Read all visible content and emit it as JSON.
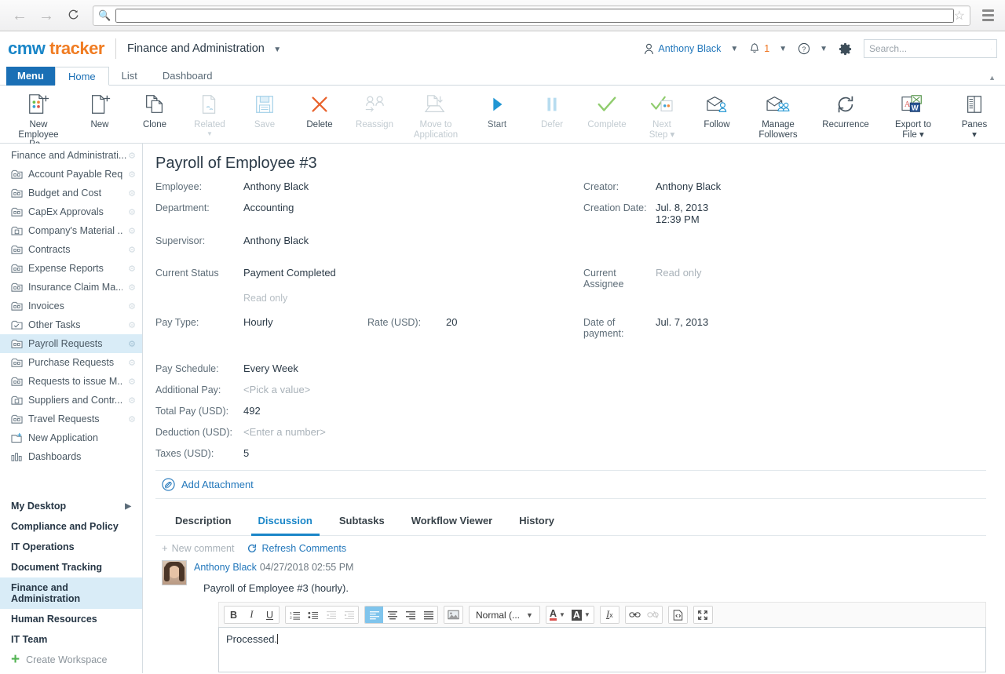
{
  "browser": {
    "back_icon": "back-arrow-icon",
    "forward_icon": "forward-arrow-icon",
    "reload_icon": "reload-icon",
    "url_value": "",
    "url_placeholder": "",
    "star_icon": "bookmark-star-icon",
    "menu_icon": "browser-menu-icon"
  },
  "header": {
    "logo_cmw": "cmw",
    "logo_tracker": "tracker",
    "workspace": "Finance and Administration",
    "user_name": "Anthony Black",
    "notifications_count": "1",
    "help_icon": "help-question-icon",
    "settings_icon": "gear-icon",
    "search_placeholder": "Search...",
    "search_value": ""
  },
  "ribbon_tabs": [
    {
      "label": "Menu",
      "state": "menu"
    },
    {
      "label": "Home",
      "state": "active"
    },
    {
      "label": "List",
      "state": "normal"
    },
    {
      "label": "Dashboard",
      "state": "normal"
    }
  ],
  "toolbar": {
    "items": [
      {
        "label": "New\nEmployee Pa...",
        "line1": "New",
        "line2": "Employee Pa...",
        "icon": "new-employee-payroll-icon",
        "disabled": false
      },
      {
        "label": "New",
        "line1": "New",
        "line2": "",
        "icon": "new-document-icon",
        "disabled": false
      },
      {
        "label": "Clone",
        "line1": "Clone",
        "line2": "",
        "icon": "clone-icon",
        "disabled": false
      },
      {
        "label": "Related",
        "line1": "Related",
        "line2": "",
        "icon": "related-icon",
        "disabled": true
      },
      {
        "label": "Save",
        "line1": "Save",
        "line2": "",
        "icon": "save-disk-icon",
        "disabled": true
      },
      {
        "label": "Delete",
        "line1": "Delete",
        "line2": "",
        "icon": "delete-x-icon",
        "disabled": false
      },
      {
        "label": "Reassign",
        "line1": "Reassign",
        "line2": "",
        "icon": "reassign-users-icon",
        "disabled": true
      },
      {
        "label": "Move to Application",
        "line1": "Move to",
        "line2": "Application",
        "icon": "move-to-application-icon",
        "disabled": true
      },
      {
        "label": "Start",
        "line1": "Start",
        "line2": "",
        "icon": "start-play-icon",
        "disabled": false
      },
      {
        "label": "Defer",
        "line1": "Defer",
        "line2": "",
        "icon": "defer-pause-icon",
        "disabled": true
      },
      {
        "label": "Complete",
        "line1": "Complete",
        "line2": "",
        "icon": "complete-check-icon",
        "disabled": true
      },
      {
        "label": "Next Step",
        "line1": "Next",
        "line2": "Step ▾",
        "icon": "next-step-icon",
        "disabled": true
      },
      {
        "label": "Follow",
        "line1": "Follow",
        "line2": "",
        "icon": "follow-envelope-icon",
        "disabled": false
      },
      {
        "label": "Manage Followers",
        "line1": "Manage",
        "line2": "Followers",
        "icon": "manage-followers-icon",
        "disabled": false
      },
      {
        "label": "Recurrence",
        "line1": "Recurrence",
        "line2": "",
        "icon": "recurrence-refresh-icon",
        "disabled": false
      },
      {
        "label": "Export to File",
        "line1": "Export to",
        "line2": "File ▾",
        "icon": "export-to-file-icon",
        "disabled": false
      },
      {
        "label": "Panes",
        "line1": "Panes",
        "line2": "▾",
        "icon": "panes-icon",
        "disabled": false
      }
    ]
  },
  "sidebar": {
    "root_label": "Finance and Administrati...",
    "apps": [
      {
        "label": "Account Payable Req...",
        "icon": "application-icon"
      },
      {
        "label": "Budget and Cost",
        "icon": "application-icon"
      },
      {
        "label": "CapEx Approvals",
        "icon": "application-icon"
      },
      {
        "label": "Company's Material ...",
        "icon": "application-record-icon"
      },
      {
        "label": "Contracts",
        "icon": "application-icon"
      },
      {
        "label": "Expense Reports",
        "icon": "application-icon"
      },
      {
        "label": "Insurance Claim Ma...",
        "icon": "application-icon"
      },
      {
        "label": "Invoices",
        "icon": "application-icon"
      },
      {
        "label": "Other Tasks",
        "icon": "application-check-icon"
      },
      {
        "label": "Payroll Requests",
        "icon": "application-icon",
        "selected": true
      },
      {
        "label": "Purchase Requests",
        "icon": "application-icon"
      },
      {
        "label": "Requests to issue M...",
        "icon": "application-icon"
      },
      {
        "label": "Suppliers and Contr...",
        "icon": "application-record-icon"
      },
      {
        "label": "Travel Requests",
        "icon": "application-icon"
      }
    ],
    "new_application": {
      "label": "New Application",
      "icon": "new-application-icon"
    },
    "dashboards": {
      "label": "Dashboards",
      "icon": "dashboards-bars-icon"
    },
    "workspaces": [
      {
        "label": "My Desktop",
        "has_chevron": true
      },
      {
        "label": "Compliance and Policy"
      },
      {
        "label": "IT Operations"
      },
      {
        "label": "Document Tracking"
      },
      {
        "label": "Finance and Administration",
        "selected": true
      },
      {
        "label": "Human Resources"
      },
      {
        "label": "IT Team"
      }
    ],
    "create_workspace": "Create Workspace"
  },
  "record": {
    "title": "Payroll of Employee #3",
    "fields_left": [
      {
        "label": "Employee:",
        "value": "Anthony Black",
        "muted": false
      },
      {
        "label": "Department:",
        "value": "Accounting",
        "muted": false
      },
      {
        "label": "Supervisor:",
        "value": "Anthony Black",
        "muted": false
      }
    ],
    "fields_right": [
      {
        "label": "Creator:",
        "value": "Anthony Black",
        "muted": false
      },
      {
        "label": "Creation Date:",
        "value": "Jul. 8, 2013 12:39 PM",
        "muted": false
      }
    ],
    "status": {
      "label": "Current Status",
      "value": "Payment Completed",
      "sub": "Read only"
    },
    "assignee": {
      "label": "Current Assignee",
      "value": "Read only",
      "muted": true
    },
    "pay_type": {
      "label": "Pay Type:",
      "value": "Hourly"
    },
    "rate": {
      "label": "Rate (USD):",
      "value": "20"
    },
    "date_of_payment": {
      "label": "Date of payment:",
      "value": "Jul. 7, 2013"
    },
    "pay_schedule": {
      "label": "Pay Schedule:",
      "value": "Every Week"
    },
    "additional_pay": {
      "label": "Additional Pay:",
      "value": "<Pick a value>",
      "muted": true
    },
    "total_pay": {
      "label": "Total Pay (USD):",
      "value": "492"
    },
    "deduction": {
      "label": "Deduction (USD):",
      "value": "<Enter a number>",
      "muted": true
    },
    "taxes": {
      "label": "Taxes (USD):",
      "value": "5"
    },
    "add_attachment": "Add Attachment"
  },
  "tabs": [
    {
      "label": "Description",
      "active": false
    },
    {
      "label": "Discussion",
      "active": true
    },
    {
      "label": "Subtasks",
      "active": false
    },
    {
      "label": "Workflow Viewer",
      "active": false
    },
    {
      "label": "History",
      "active": false
    }
  ],
  "discussion": {
    "new_comment": "New comment",
    "refresh_comments": "Refresh Comments",
    "comments": [
      {
        "author": "Anthony Black",
        "date": "04/27/2018 02:55 PM",
        "text": "Payroll of Employee #3 (hourly)."
      }
    ],
    "editor": {
      "value": "Processed.",
      "format_select": "Normal (...",
      "buttons": [
        {
          "name": "bold",
          "glyph": "B",
          "state": "normal"
        },
        {
          "name": "italic",
          "glyph": "I",
          "state": "normal"
        },
        {
          "name": "underline",
          "glyph": "U",
          "state": "normal"
        },
        {
          "name": "numbered-list",
          "glyph": "",
          "state": "normal"
        },
        {
          "name": "bulleted-list",
          "glyph": "",
          "state": "normal"
        },
        {
          "name": "decrease-indent",
          "glyph": "",
          "state": "disabled"
        },
        {
          "name": "increase-indent",
          "glyph": "",
          "state": "disabled"
        },
        {
          "name": "align-left",
          "glyph": "",
          "state": "selected"
        },
        {
          "name": "align-center",
          "glyph": "",
          "state": "normal"
        },
        {
          "name": "align-right",
          "glyph": "",
          "state": "normal"
        },
        {
          "name": "align-justify",
          "glyph": "",
          "state": "normal"
        },
        {
          "name": "insert-image",
          "glyph": "",
          "state": "normal"
        },
        {
          "name": "text-color",
          "glyph": "A",
          "state": "normal"
        },
        {
          "name": "background-color",
          "glyph": "A",
          "state": "normal"
        },
        {
          "name": "remove-format",
          "glyph": "I",
          "state": "normal"
        },
        {
          "name": "insert-link",
          "glyph": "",
          "state": "normal"
        },
        {
          "name": "unlink",
          "glyph": "",
          "state": "disabled"
        },
        {
          "name": "source-code",
          "glyph": "",
          "state": "normal"
        },
        {
          "name": "fullscreen",
          "glyph": "",
          "state": "normal"
        }
      ]
    }
  },
  "colors": {
    "brand_blue": "#1a86c8",
    "brand_orange": "#f07c22",
    "menu_blue": "#1a6fb5",
    "link_blue": "#2277bb",
    "selection_bg": "#d9ecf7",
    "text_dark": "#2b3a47",
    "text_muted": "#5e6d78"
  }
}
